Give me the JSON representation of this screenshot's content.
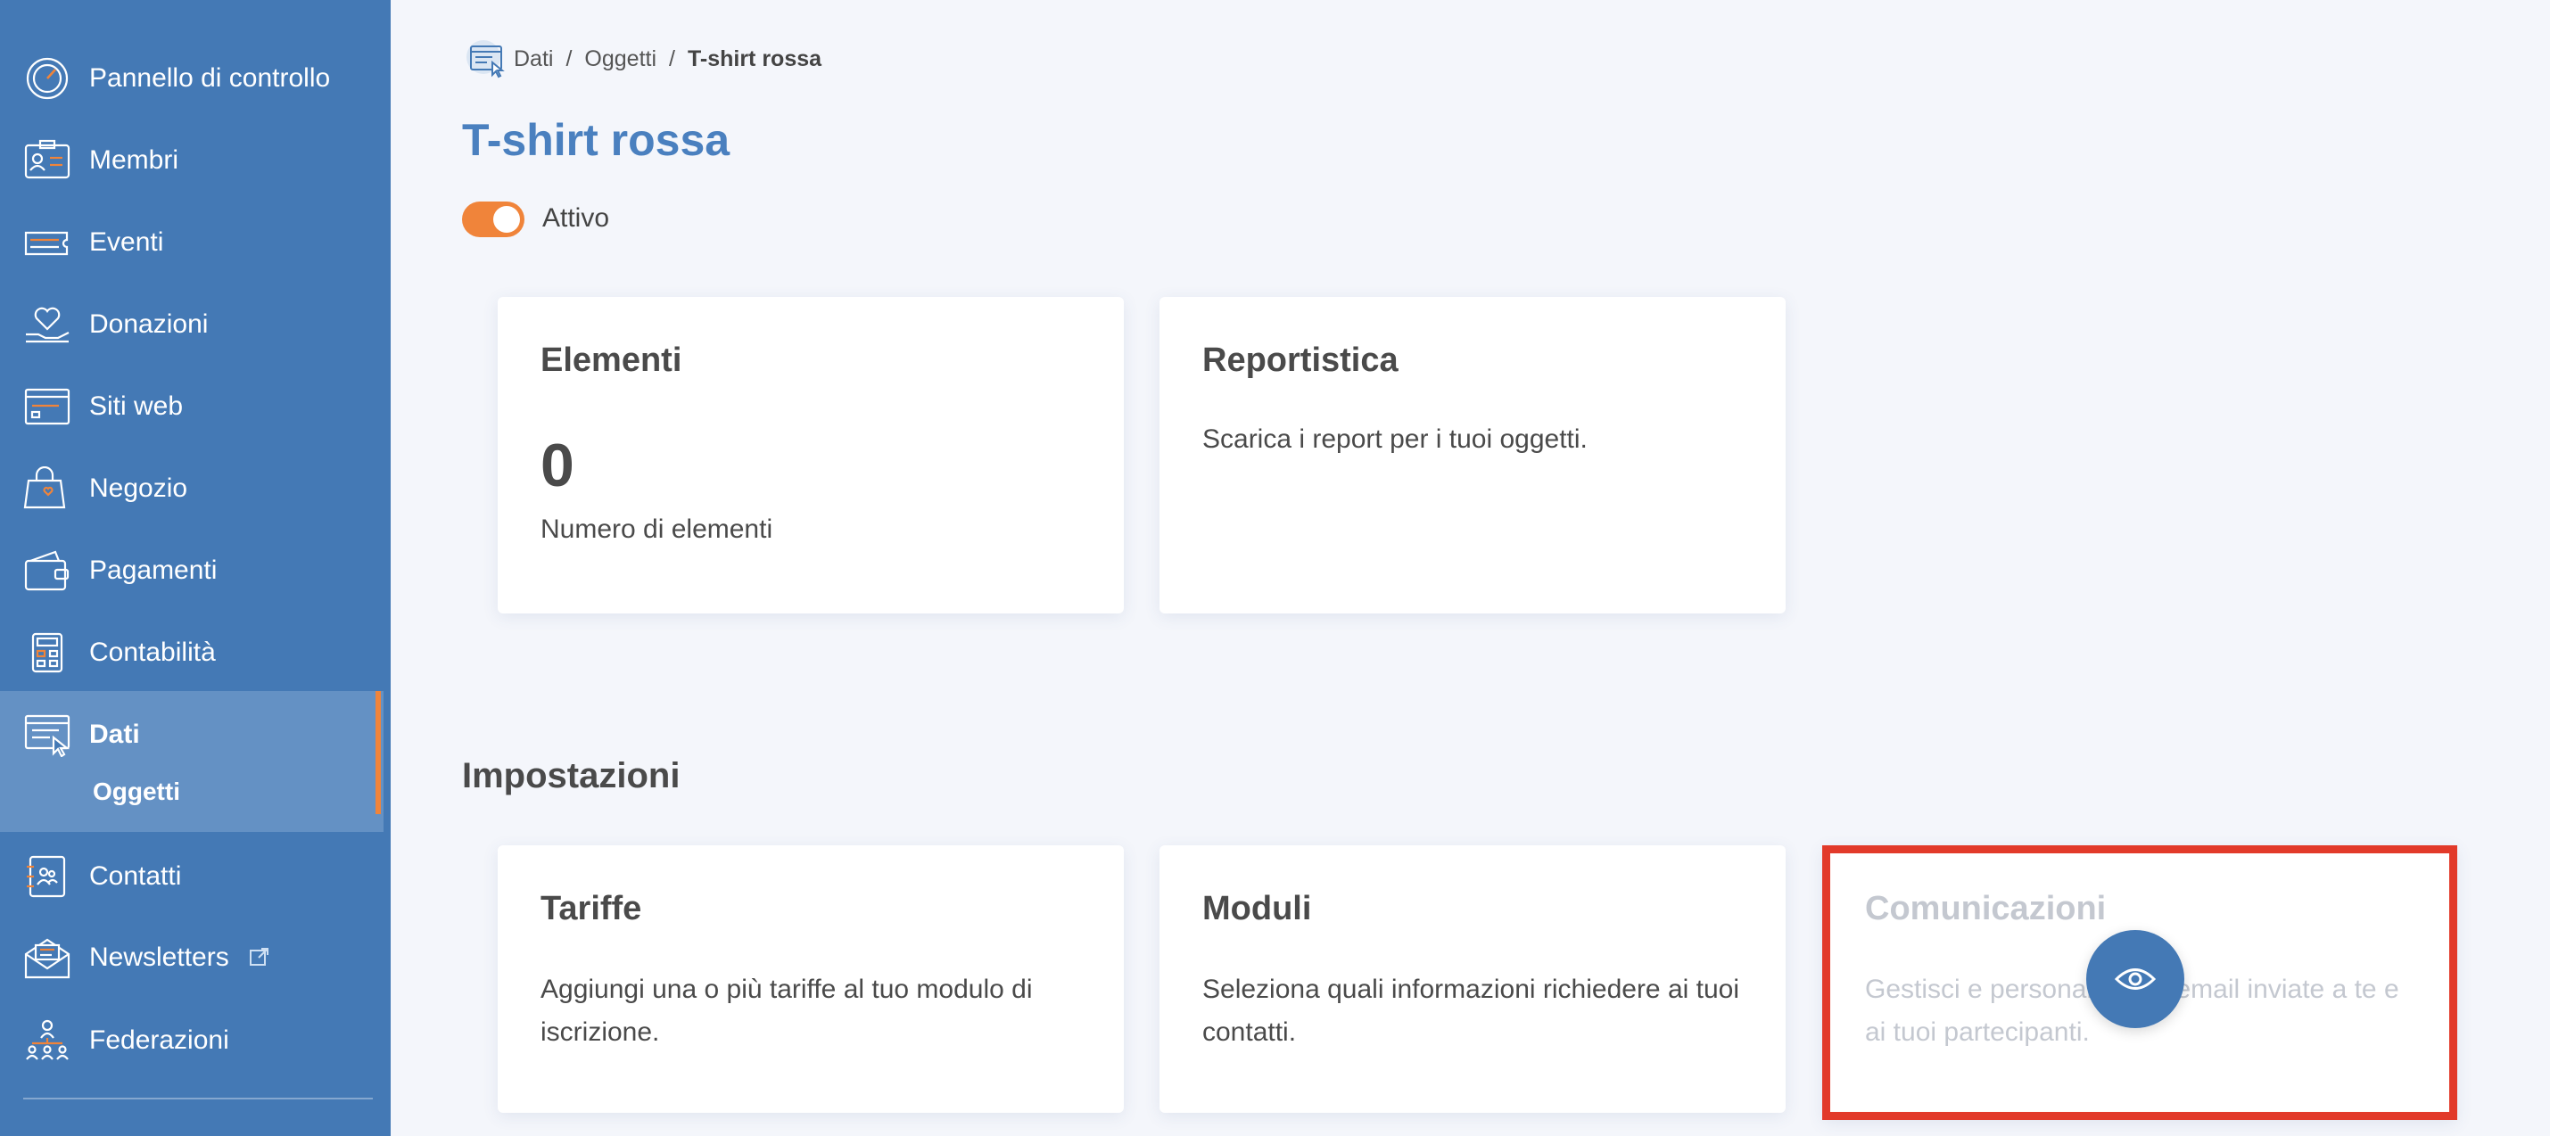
{
  "sidebar": {
    "items": [
      {
        "label": "Pannello di controllo",
        "icon": "dashboard-gauge-icon"
      },
      {
        "label": "Membri",
        "icon": "member-card-icon"
      },
      {
        "label": "Eventi",
        "icon": "ticket-icon"
      },
      {
        "label": "Donazioni",
        "icon": "heart-hand-icon"
      },
      {
        "label": "Siti web",
        "icon": "website-icon"
      },
      {
        "label": "Negozio",
        "icon": "shopping-bag-icon"
      },
      {
        "label": "Pagamenti",
        "icon": "wallet-icon"
      },
      {
        "label": "Contabilità",
        "icon": "calculator-icon"
      },
      {
        "label": "Dati",
        "icon": "data-cursor-icon"
      },
      {
        "label": "Contatti",
        "icon": "contacts-book-icon"
      },
      {
        "label": "Newsletters",
        "icon": "envelope-icon"
      },
      {
        "label": "Federazioni",
        "icon": "federation-people-icon"
      }
    ],
    "active_sub": "Oggetti",
    "colors": {
      "background": "#4479b5",
      "active": "#6491c4",
      "accent": "#f0843a"
    }
  },
  "breadcrumb": {
    "items": [
      "Dati",
      "Oggetti"
    ],
    "current": "T-shirt rossa",
    "separator": "/"
  },
  "page": {
    "title": "T-shirt rossa",
    "status_label": "Attivo",
    "status_on": true
  },
  "cards": {
    "elementi": {
      "title": "Elementi",
      "value": "0",
      "caption": "Numero di elementi"
    },
    "reportistica": {
      "title": "Reportistica",
      "text": "Scarica i report per i tuoi oggetti."
    }
  },
  "settings": {
    "title": "Impostazioni",
    "tariffe": {
      "title": "Tariffe",
      "text": "Aggiungi una o più tariffe al tuo modulo di iscrizione."
    },
    "moduli": {
      "title": "Moduli",
      "text": "Seleziona quali informazioni richiedere ai tuoi contatti."
    },
    "comunicazioni": {
      "title": "Comunicazioni",
      "text": "Gestisci e personalizza le email inviate a te e ai tuoi partecipanti.",
      "disabled": true
    }
  },
  "colors": {
    "title": "#4a80bf",
    "highlight": "#e23a2a",
    "toggle": "#f0843a"
  }
}
